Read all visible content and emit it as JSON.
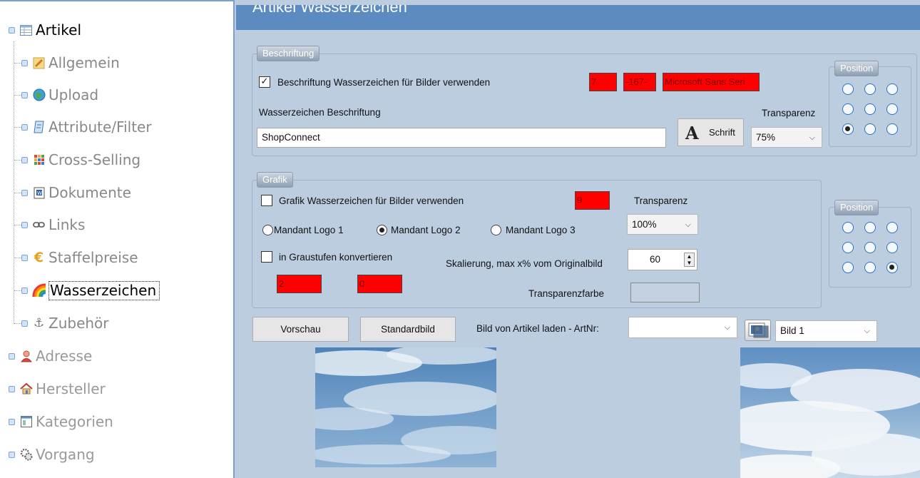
{
  "tree": {
    "root": {
      "label": "Artikel",
      "icon": "table-icon"
    },
    "children": [
      {
        "id": "allgemein",
        "label": "Allgemein",
        "icon": "pencil-icon",
        "selected": false
      },
      {
        "id": "upload",
        "label": "Upload",
        "icon": "globe-icon",
        "selected": false
      },
      {
        "id": "attribute",
        "label": "Attribute/Filter",
        "icon": "document-icon",
        "selected": false
      },
      {
        "id": "cross",
        "label": "Cross-Selling",
        "icon": "grid-icon",
        "selected": false
      },
      {
        "id": "dokumente",
        "label": "Dokumente",
        "icon": "word-doc-icon",
        "selected": false
      },
      {
        "id": "links",
        "label": "Links",
        "icon": "chain-link-icon",
        "selected": false
      },
      {
        "id": "staffel",
        "label": "Staffelpreise",
        "icon": "euro-icon",
        "selected": false
      },
      {
        "id": "wasser",
        "label": "Wasserzeichen",
        "icon": "rainbow-icon",
        "selected": true
      },
      {
        "id": "zubehoer",
        "label": "Zubehör",
        "icon": "anchor-icon",
        "selected": false
      }
    ],
    "siblings": [
      {
        "id": "adresse",
        "label": "Adresse",
        "icon": "person-icon"
      },
      {
        "id": "hersteller",
        "label": "Hersteller",
        "icon": "house-icon"
      },
      {
        "id": "kategorien",
        "label": "Kategorien",
        "icon": "window-icon"
      },
      {
        "id": "vorgang",
        "label": "Vorgang",
        "icon": "gears-icon"
      }
    ]
  },
  "main": {
    "title": "Artikel Wasserzeichen",
    "beschriftung": {
      "legend": "Beschriftung",
      "use_label": "Beschriftung Wasserzeichen für Bilder verwenden",
      "use_checked": true,
      "red_fields": [
        "7",
        "-167-",
        "Microsoft Sans Seri"
      ],
      "text_label": "Wasserzeichen Beschriftung",
      "text_value": "ShopConnect",
      "font_button": "Schrift",
      "transparenz_label": "Transparenz",
      "transparenz_value": "75%",
      "position_legend": "Position",
      "position_selected": 6
    },
    "grafik": {
      "legend": "Grafik",
      "use_label": "Grafik Wasserzeichen für Bilder verwenden",
      "use_checked": false,
      "red_field": "9",
      "transparenz_label": "Transparenz",
      "transparenz_value": "100%",
      "logo_options": [
        "Mandant Logo 1",
        "Mandant Logo 2",
        "Mandant Logo 3"
      ],
      "logo_selected": 1,
      "graustufen_label": "in Graustufen konvertieren",
      "graustufen_checked": false,
      "skalierung_label": "Skalierung, max x% vom Originalbild",
      "skalierung_value": "60",
      "red_fields": [
        "2",
        "0"
      ],
      "transparenzfarbe_label": "Transparenzfarbe",
      "position_legend": "Position",
      "position_selected": 8
    },
    "actions": {
      "vorschau": "Vorschau",
      "standardbild": "Standardbild",
      "artnr_label": "Bild von Artikel laden - ArtNr:",
      "artnr_value": "",
      "bild_value": "Bild 1"
    },
    "colors": {
      "title_bar": "#5b8bc0",
      "panel": "#bccde0",
      "red_field": "#ff0000",
      "tree_border": "#7d9fd0"
    }
  }
}
